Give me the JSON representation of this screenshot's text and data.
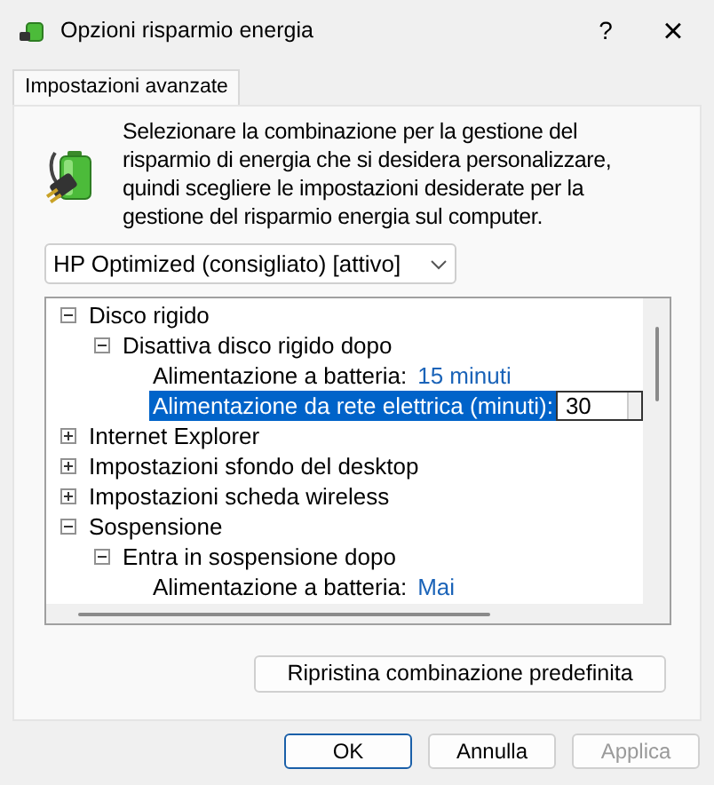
{
  "window": {
    "title": "Opzioni risparmio energia",
    "help": "?",
    "close": "×"
  },
  "tabs": [
    {
      "label": "Impostazioni avanzate",
      "selected": true
    }
  ],
  "description": "Selezionare la combinazione per la gestione del risparmio di energia che si desidera personalizzare, quindi scegliere le impostazioni desiderate per la gestione del risparmio energia sul computer.",
  "plan_dropdown": {
    "value": "HP Optimized (consigliato) [attivo]"
  },
  "tree": [
    {
      "label": "Disco rigido",
      "expanded": true,
      "children": [
        {
          "label": "Disattiva disco rigido dopo",
          "expanded": true,
          "children": [
            {
              "kind": "value",
              "label": "Alimentazione a batteria:",
              "value": "15 minuti",
              "selected": false
            },
            {
              "kind": "edit",
              "label": "Alimentazione da rete elettrica (minuti):",
              "value": "30",
              "selected": true
            }
          ]
        }
      ]
    },
    {
      "label": "Internet Explorer",
      "expanded": false
    },
    {
      "label": "Impostazioni sfondo del desktop",
      "expanded": false
    },
    {
      "label": "Impostazioni scheda wireless",
      "expanded": false
    },
    {
      "label": "Sospensione",
      "expanded": true,
      "children": [
        {
          "label": "Entra in sospensione dopo",
          "expanded": true,
          "children": [
            {
              "kind": "value",
              "label": "Alimentazione a batteria:",
              "value": "Mai",
              "selected": false
            }
          ]
        }
      ]
    }
  ],
  "restore_button": "Ripristina combinazione predefinita",
  "buttons": [
    {
      "label": "OK",
      "kind": "default",
      "disabled": false
    },
    {
      "label": "Annulla",
      "kind": "normal",
      "disabled": false
    },
    {
      "label": "Applica",
      "kind": "normal",
      "disabled": true
    }
  ]
}
